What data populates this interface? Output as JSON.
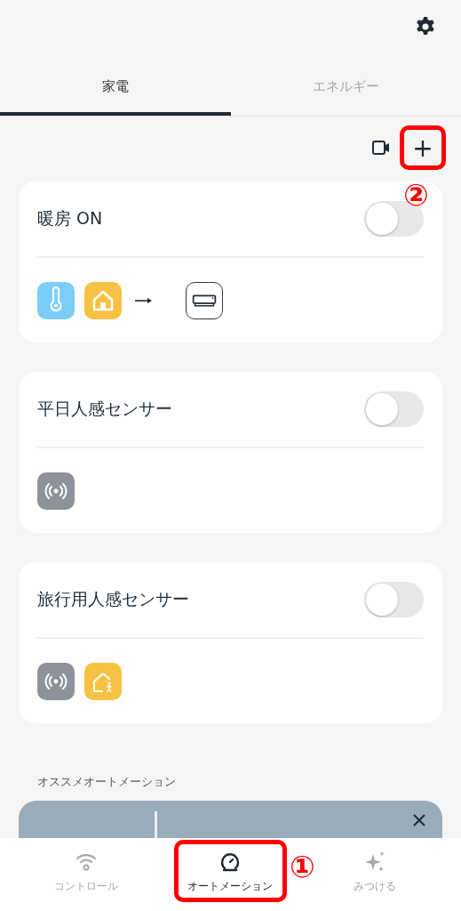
{
  "tabs": [
    {
      "label": "家電",
      "selected": true
    },
    {
      "label": "エネルギー",
      "selected": false
    }
  ],
  "toolbar": {
    "add_button": {
      "label": "+",
      "highlighted": true
    }
  },
  "automations": [
    {
      "name": "暖房 ON",
      "on": false,
      "icons": [
        {
          "kind": "thermometer"
        },
        {
          "kind": "home"
        },
        {
          "kind": "arrow"
        },
        {
          "kind": "aircon"
        }
      ]
    },
    {
      "name": "平日人感センサー",
      "on": false,
      "icons": [
        {
          "kind": "sensor"
        }
      ]
    },
    {
      "name": "旅行用人感センサー",
      "on": false,
      "icons": [
        {
          "kind": "sensor"
        },
        {
          "kind": "home-person"
        }
      ]
    }
  ],
  "recommended": {
    "title": "オススメオートメーション"
  },
  "nav": [
    {
      "label": "コントロール",
      "kind": "wifi",
      "selected": false,
      "highlighted": false
    },
    {
      "label": "オートメーション",
      "kind": "gauge",
      "selected": true,
      "highlighted": true
    },
    {
      "label": "みつける",
      "kind": "sparkle",
      "selected": false,
      "highlighted": false
    }
  ],
  "annotations": [
    {
      "label": "②",
      "kind": "add"
    },
    {
      "label": "①",
      "kind": "nav"
    }
  ]
}
